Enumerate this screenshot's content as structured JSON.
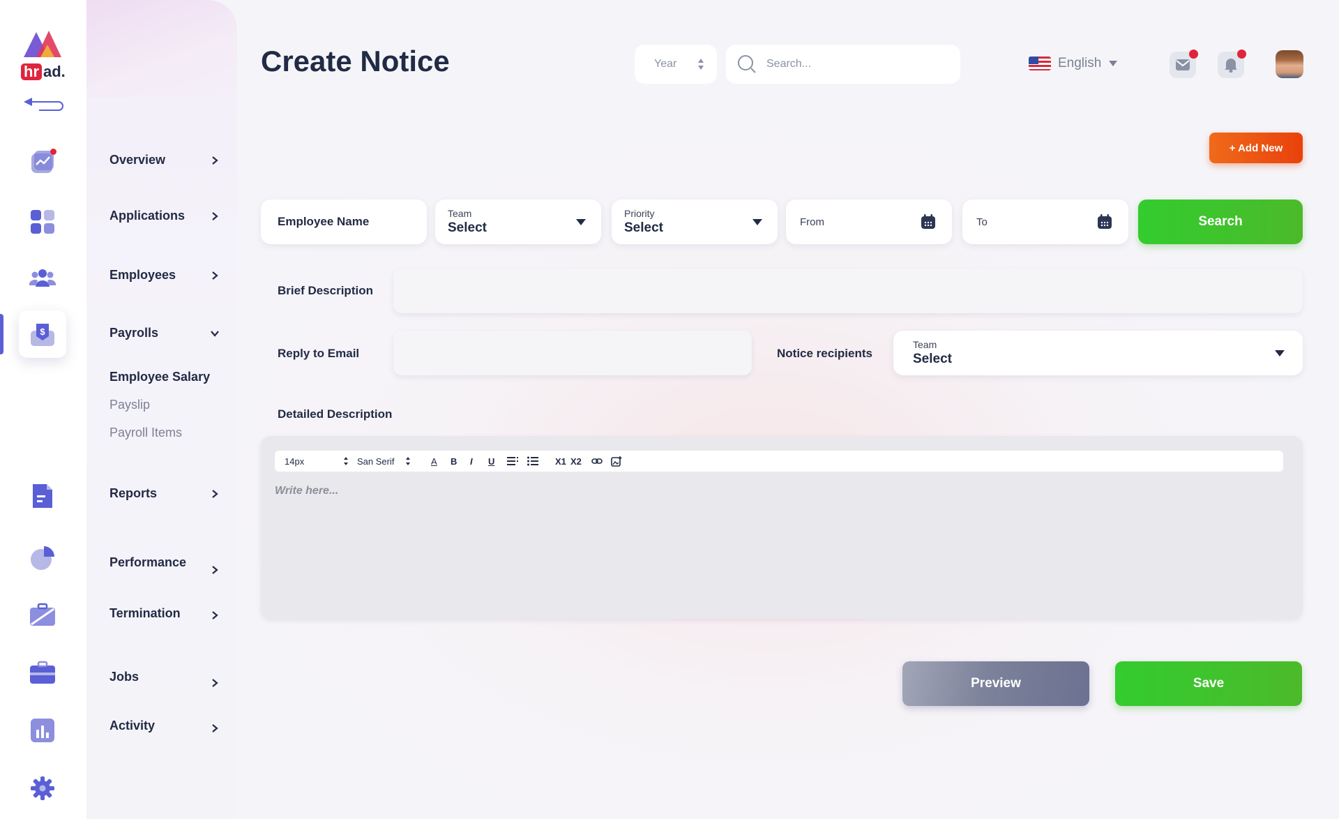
{
  "brand": {
    "logo_hr": "hr",
    "logo_ad": "ad."
  },
  "header": {
    "title": "Create Notice",
    "year_label": "Year",
    "search_placeholder": "Search...",
    "language": "English"
  },
  "rail": {
    "icons": [
      "overview-chart-icon",
      "applications-grid-icon",
      "employees-group-icon",
      "payrolls-dollar-icon",
      "reports-document-icon",
      "performance-pie-icon",
      "termination-briefcase-icon",
      "jobs-briefcase-icon",
      "activity-bar-chart-icon",
      "settings-gear-icon"
    ],
    "accent_color": "#5a5fd6",
    "badge_color": "#e0243c"
  },
  "menu": {
    "items": [
      {
        "label": "Overview"
      },
      {
        "label": "Applications"
      },
      {
        "label": "Employees"
      },
      {
        "label": "Payrolls"
      },
      {
        "label": "Reports"
      },
      {
        "label": "Performance"
      },
      {
        "label": "Termination"
      },
      {
        "label": "Jobs"
      },
      {
        "label": "Activity"
      }
    ],
    "payroll_sub": [
      "Employee Salary",
      "Payslip",
      "Payroll Items"
    ]
  },
  "actions": {
    "add_new": "+ Add New",
    "search": "Search",
    "preview": "Preview",
    "save": "Save"
  },
  "filters": {
    "employee_name": "Employee Name",
    "team_label": "Team",
    "team_value": "Select",
    "priority_label": "Priority",
    "priority_value": "Select",
    "from_label": "From",
    "to_label": "To"
  },
  "form": {
    "brief_description": "Brief Description",
    "reply_email": "Reply to Email",
    "notice_recipients": "Notice recipients",
    "recipients_team_label": "Team",
    "recipients_team_value": "Select",
    "detailed_description": "Detailed Description"
  },
  "editor": {
    "font_size": "14px",
    "font_family": "San Serif",
    "color_btn": "A",
    "bold_btn": "B",
    "italic_btn": "I",
    "underline_btn": "U",
    "subscript_btn": "X1",
    "superscript_btn": "X2",
    "placeholder": "Write here..."
  },
  "colors": {
    "green": "#33cc2f",
    "orange": "#e9410c",
    "navy": "#222b45"
  }
}
